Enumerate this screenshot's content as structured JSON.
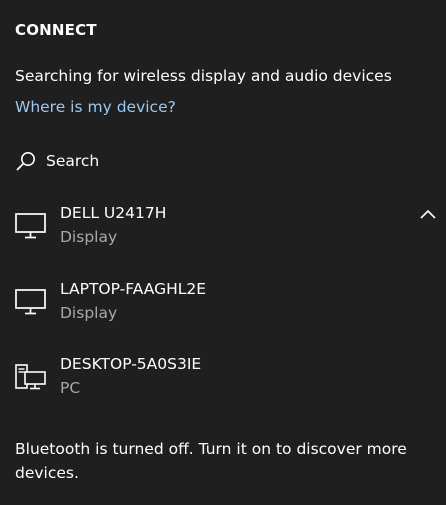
{
  "connect": {
    "title": "CONNECT",
    "status_text": "Searching for wireless display and audio devices",
    "help_link": "Where is my device?",
    "search_label": "Search",
    "devices": [
      {
        "name": "DELL U2417H",
        "type": "Display",
        "icon": "monitor-icon",
        "expanded": true
      },
      {
        "name": "LAPTOP-FAAGHL2E",
        "type": "Display",
        "icon": "monitor-icon"
      },
      {
        "name": "DESKTOP-5A0S3IE",
        "type": "PC",
        "icon": "pc-icon"
      }
    ],
    "bluetooth_note": "Bluetooth is turned off. Turn it on to discover more devices."
  },
  "colors": {
    "background": "#1f1f1f",
    "text": "#ffffff",
    "secondary_text": "#a9a9a9",
    "link": "#99c9f0"
  }
}
